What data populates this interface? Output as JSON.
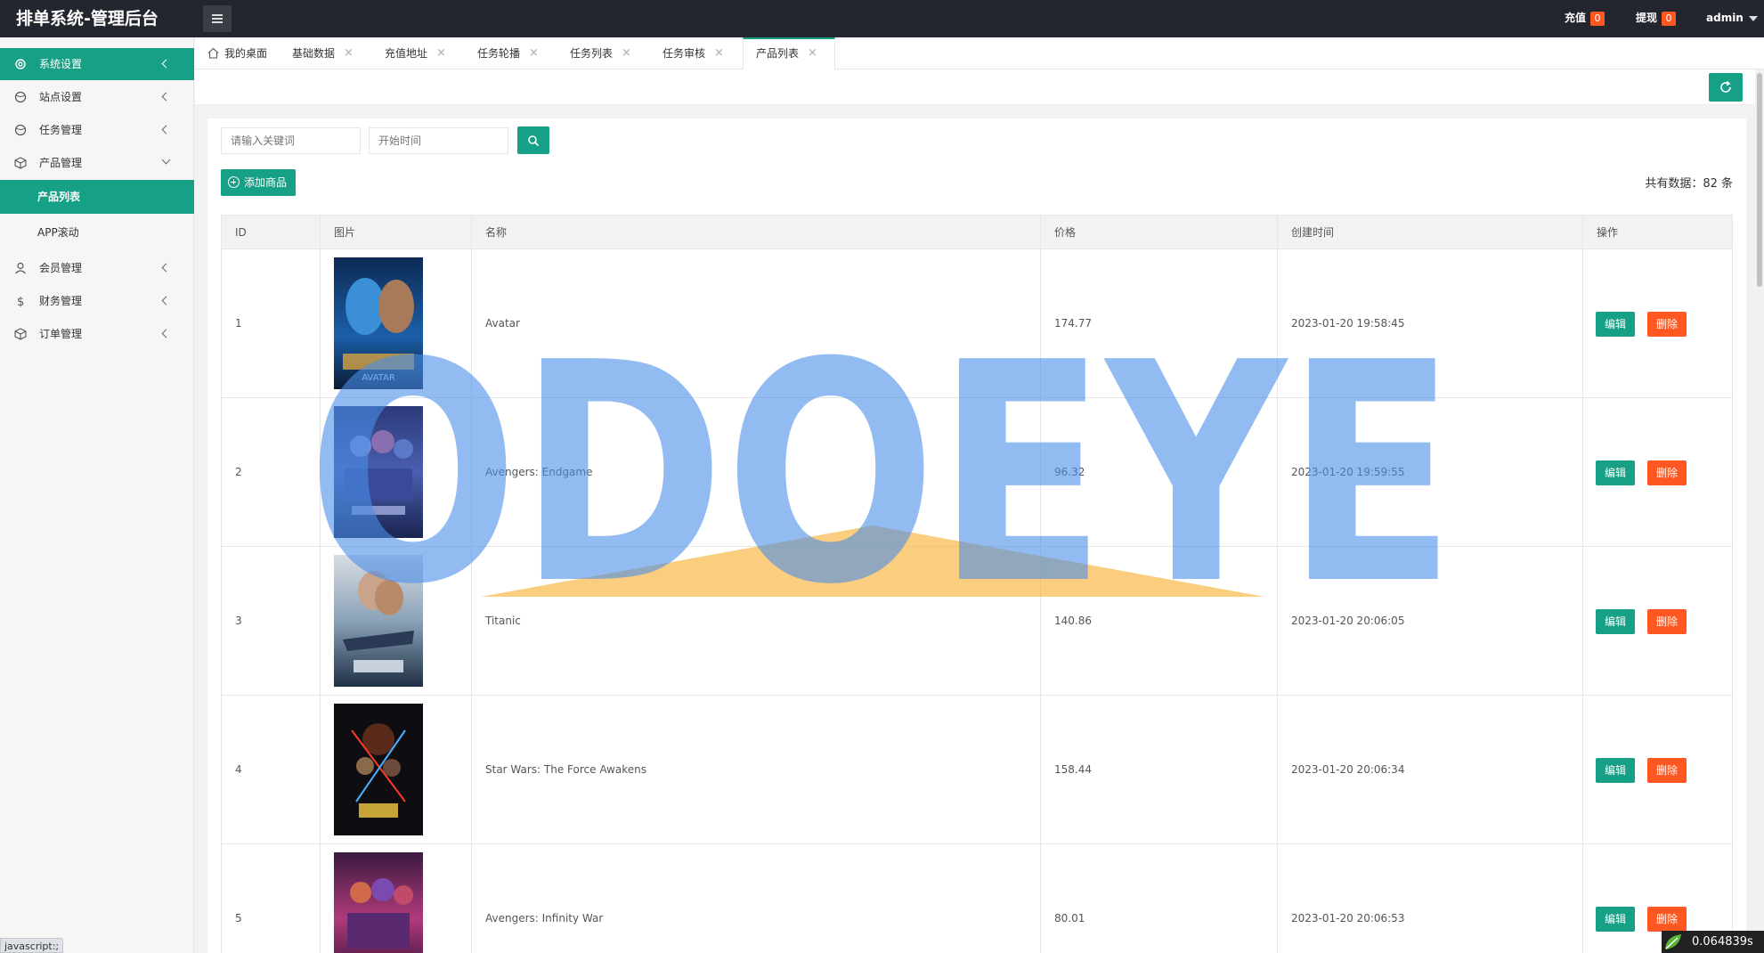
{
  "app": {
    "title": "排单系统-管理后台"
  },
  "topbar": {
    "recharge_label": "充值",
    "recharge_count": "0",
    "withdraw_label": "提现",
    "withdraw_count": "0",
    "user": "admin"
  },
  "sidebar": {
    "items": [
      {
        "label": "系统设置",
        "icon": "gear-icon"
      },
      {
        "label": "站点设置",
        "icon": "globe-icon"
      },
      {
        "label": "任务管理",
        "icon": "globe-icon"
      },
      {
        "label": "产品管理",
        "icon": "box-icon"
      },
      {
        "label": "产品列表"
      },
      {
        "label": "APP滚动"
      },
      {
        "label": "会员管理",
        "icon": "user-icon"
      },
      {
        "label": "财务管理",
        "icon": "dollar-icon"
      },
      {
        "label": "订单管理",
        "icon": "box-icon"
      }
    ]
  },
  "tabs": [
    {
      "label": "我的桌面"
    },
    {
      "label": "基础数据"
    },
    {
      "label": "充值地址"
    },
    {
      "label": "任务轮播"
    },
    {
      "label": "任务列表"
    },
    {
      "label": "任务审核"
    },
    {
      "label": "产品列表"
    }
  ],
  "search": {
    "keyword_placeholder": "请输入关键词",
    "date_placeholder": "开始时间"
  },
  "toolbar": {
    "add_label": "添加商品",
    "total": "共有数据：82 条"
  },
  "table": {
    "columns": [
      "ID",
      "图片",
      "名称",
      "价格",
      "创建时间",
      "操作"
    ],
    "rows": [
      {
        "id": "1",
        "name": "Avatar",
        "price": "174.77",
        "created": "2023-01-20 19:58:45"
      },
      {
        "id": "2",
        "name": "Avengers: Endgame",
        "price": "96.32",
        "created": "2023-01-20 19:59:55"
      },
      {
        "id": "3",
        "name": "Titanic",
        "price": "140.86",
        "created": "2023-01-20 20:06:05"
      },
      {
        "id": "4",
        "name": "Star Wars: The Force Awakens",
        "price": "158.44",
        "created": "2023-01-20 20:06:34"
      },
      {
        "id": "5",
        "name": "Avengers: Infinity War",
        "price": "80.01",
        "created": "2023-01-20 20:06:53"
      }
    ],
    "edit_label": "编辑",
    "delete_label": "删除"
  },
  "watermark": {
    "text": "ODOEYE"
  },
  "status": {
    "url": "javascript:;",
    "timer": "0.064839s"
  },
  "colors": {
    "accent": "#16a085",
    "danger": "#ff5722",
    "topbar": "#23262e"
  }
}
